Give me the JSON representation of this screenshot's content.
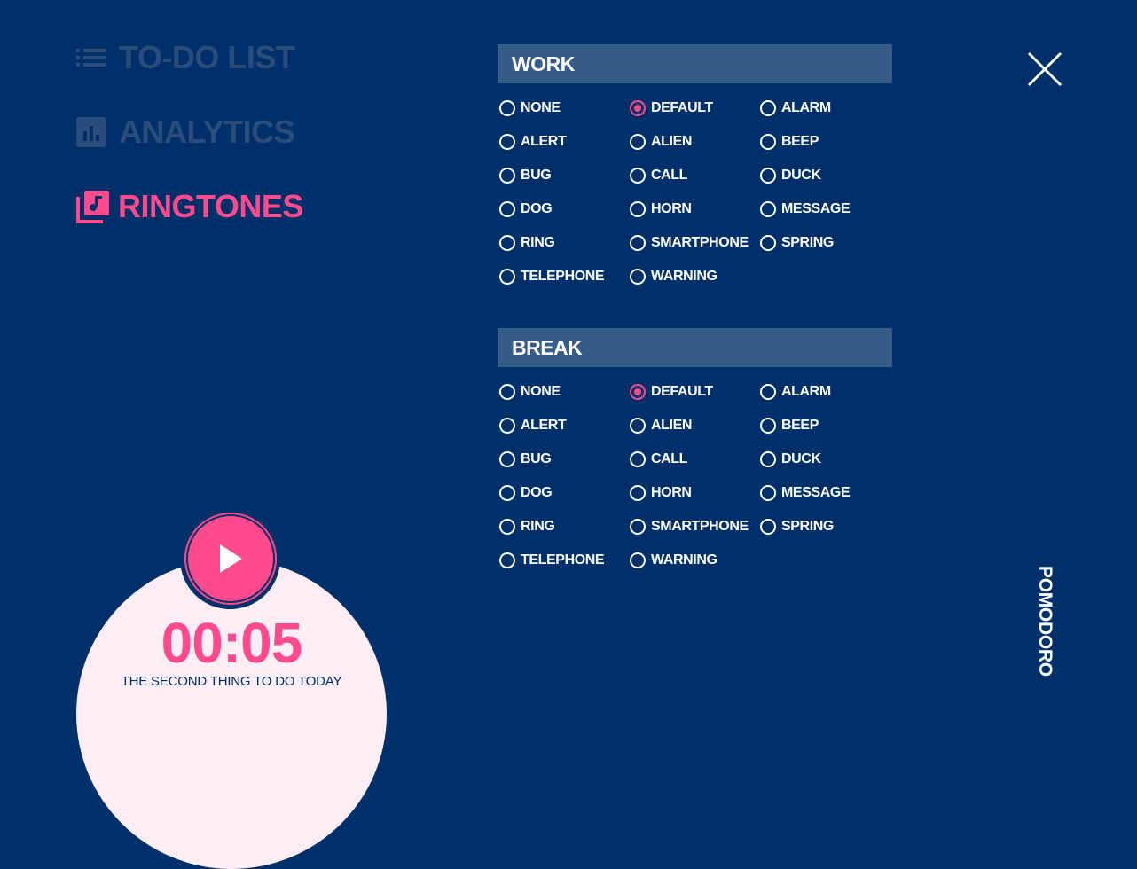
{
  "nav": {
    "items": [
      {
        "label": "TO-DO LIST",
        "icon": "list-icon",
        "active": false
      },
      {
        "label": "ANALYTICS",
        "icon": "bar-chart-icon",
        "active": false
      },
      {
        "label": "RINGTONES",
        "icon": "music-library-icon",
        "active": true
      }
    ]
  },
  "work": {
    "title": "WORK",
    "options": [
      "NONE",
      "DEFAULT",
      "ALARM",
      "ALERT",
      "ALIEN",
      "BEEP",
      "BUG",
      "CALL",
      "DUCK",
      "DOG",
      "HORN",
      "MESSAGE",
      "RING",
      "SMARTPHONE",
      "SPRING",
      "TELEPHONE",
      "WARNING"
    ],
    "selected": "DEFAULT"
  },
  "break": {
    "title": "BREAK",
    "options": [
      "NONE",
      "DEFAULT",
      "ALARM",
      "ALERT",
      "ALIEN",
      "BEEP",
      "BUG",
      "CALL",
      "DUCK",
      "DOG",
      "HORN",
      "MESSAGE",
      "RING",
      "SMARTPHONE",
      "SPRING",
      "TELEPHONE",
      "WARNING"
    ],
    "selected": "DEFAULT"
  },
  "close_icon": "close-icon",
  "brand": "POMODORO",
  "timer": {
    "time": "00:05",
    "task": "THE SECOND THING TO DO TODAY",
    "play_icon": "play-icon"
  },
  "colors": {
    "background": "#00306a",
    "accent": "#ff4a8d",
    "section_header": "#375c87",
    "muted_nav": "#2a4d7c",
    "timer_bg": "#fdedf4"
  }
}
